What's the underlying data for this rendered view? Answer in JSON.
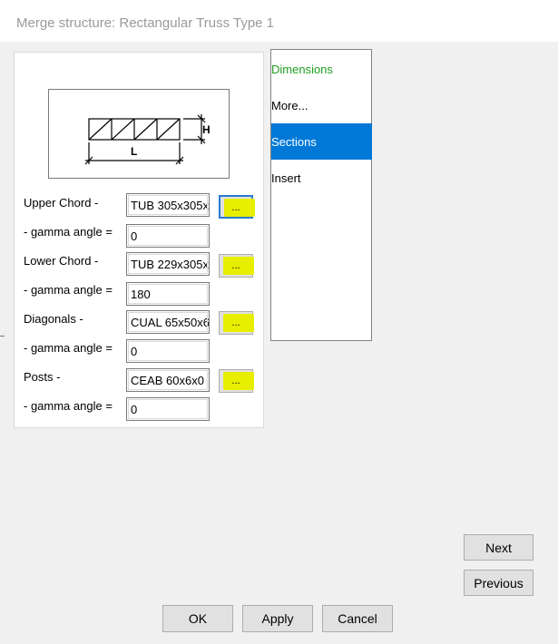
{
  "window": {
    "title": "Merge structure: Rectangular Truss Type 1"
  },
  "diagram": {
    "height_label": "H",
    "length_label": "L"
  },
  "fields": [
    {
      "label": "Upper Chord -",
      "value": "TUB 305x305x",
      "gamma_label": "- gamma angle =",
      "gamma_value": "0",
      "browse_label": "..."
    },
    {
      "label": "Lower Chord -",
      "value": "TUB 229x305x",
      "gamma_label": "- gamma angle =",
      "gamma_value": "180",
      "browse_label": "..."
    },
    {
      "label": "Diagonals -",
      "value": "CUAL 65x50x6",
      "gamma_label": "- gamma angle =",
      "gamma_value": "0",
      "browse_label": "..."
    },
    {
      "label": "Posts -",
      "value": "CEAB 60x6x0",
      "gamma_label": "- gamma angle =",
      "gamma_value": "0",
      "browse_label": "..."
    }
  ],
  "nav": {
    "items": [
      {
        "label": "Dimensions",
        "state": "visited"
      },
      {
        "label": "More...",
        "state": "normal"
      },
      {
        "label": "Sections",
        "state": "selected"
      },
      {
        "label": "Insert",
        "state": "normal"
      }
    ]
  },
  "buttons": {
    "next": "Next",
    "previous": "Previous",
    "ok": "OK",
    "apply": "Apply",
    "cancel": "Cancel"
  },
  "colors": {
    "selection": "#0078d7",
    "visited_text": "#1f9e1f",
    "highlight": "#e8ee00",
    "focus_border": "#2a7bd0"
  }
}
